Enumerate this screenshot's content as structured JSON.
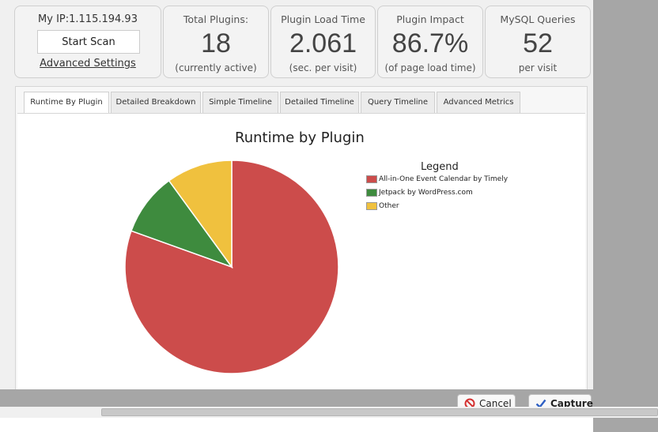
{
  "ip_card": {
    "ip_label": "My IP:1.115.194.93",
    "scan_button": "Start Scan",
    "advanced_link": "Advanced Settings"
  },
  "stats": [
    {
      "label": "Total Plugins:",
      "value": "18",
      "sub": "(currently active)"
    },
    {
      "label": "Plugin Load Time",
      "value": "2.061",
      "sub": "(sec. per visit)"
    },
    {
      "label": "Plugin Impact",
      "value": "86.7%",
      "sub": "(of page load time)"
    },
    {
      "label": "MySQL Queries",
      "value": "52",
      "sub": "per visit"
    }
  ],
  "tabs": [
    {
      "label": "Runtime By Plugin",
      "active": true
    },
    {
      "label": "Detailed Breakdown",
      "active": false
    },
    {
      "label": "Simple Timeline",
      "active": false
    },
    {
      "label": "Detailed Timeline",
      "active": false
    },
    {
      "label": "Query Timeline",
      "active": false
    },
    {
      "label": "Advanced Metrics",
      "active": false
    }
  ],
  "chart_data": {
    "type": "pie",
    "title": "Runtime by Plugin",
    "legend_title": "Legend",
    "legend_position": "right",
    "slices": [
      {
        "label": "All-in-One Event Calendar by Timely",
        "value": 80.5,
        "color": "#cc4c4b"
      },
      {
        "label": "Jetpack by WordPress.com",
        "value": 9.5,
        "color": "#3e8b3e"
      },
      {
        "label": "Other",
        "value": 10.0,
        "color": "#f0c13e"
      }
    ]
  },
  "footer": {
    "cancel_label": "Cancel",
    "capture_label": "Capture"
  },
  "colors": {
    "cancel_icon": "#d43030",
    "capture_icon": "#2d5fc4"
  }
}
